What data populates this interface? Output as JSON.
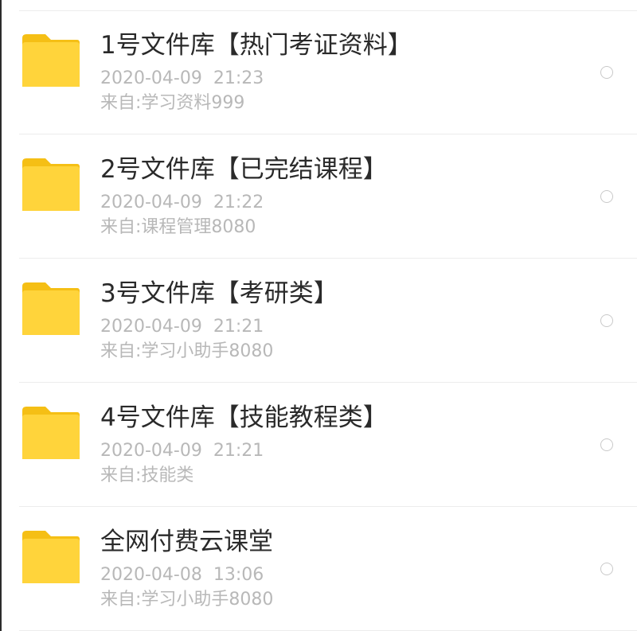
{
  "files": [
    {
      "title": "1号文件库【热门考证资料】",
      "date": "2020-04-09  21:23",
      "source": "来自:学习资料999"
    },
    {
      "title": "2号文件库【已完结课程】",
      "date": "2020-04-09  21:22",
      "source": "来自:课程管理8080"
    },
    {
      "title": "3号文件库【考研类】",
      "date": "2020-04-09  21:21",
      "source": "来自:学习小助手8080"
    },
    {
      "title": "4号文件库【技能教程类】",
      "date": "2020-04-09  21:21",
      "source": "来自:技能类"
    },
    {
      "title": "全网付费云课堂",
      "date": "2020-04-08  13:06",
      "source": "来自:学习小助手8080"
    }
  ],
  "icon": {
    "folder": "folder-icon",
    "checkbox": "radio-circle-icon"
  },
  "colors": {
    "folder": "#FFD43B",
    "folder_tab": "#F5BF15",
    "title": "#2A2A2A",
    "meta": "#B8B8B8"
  }
}
